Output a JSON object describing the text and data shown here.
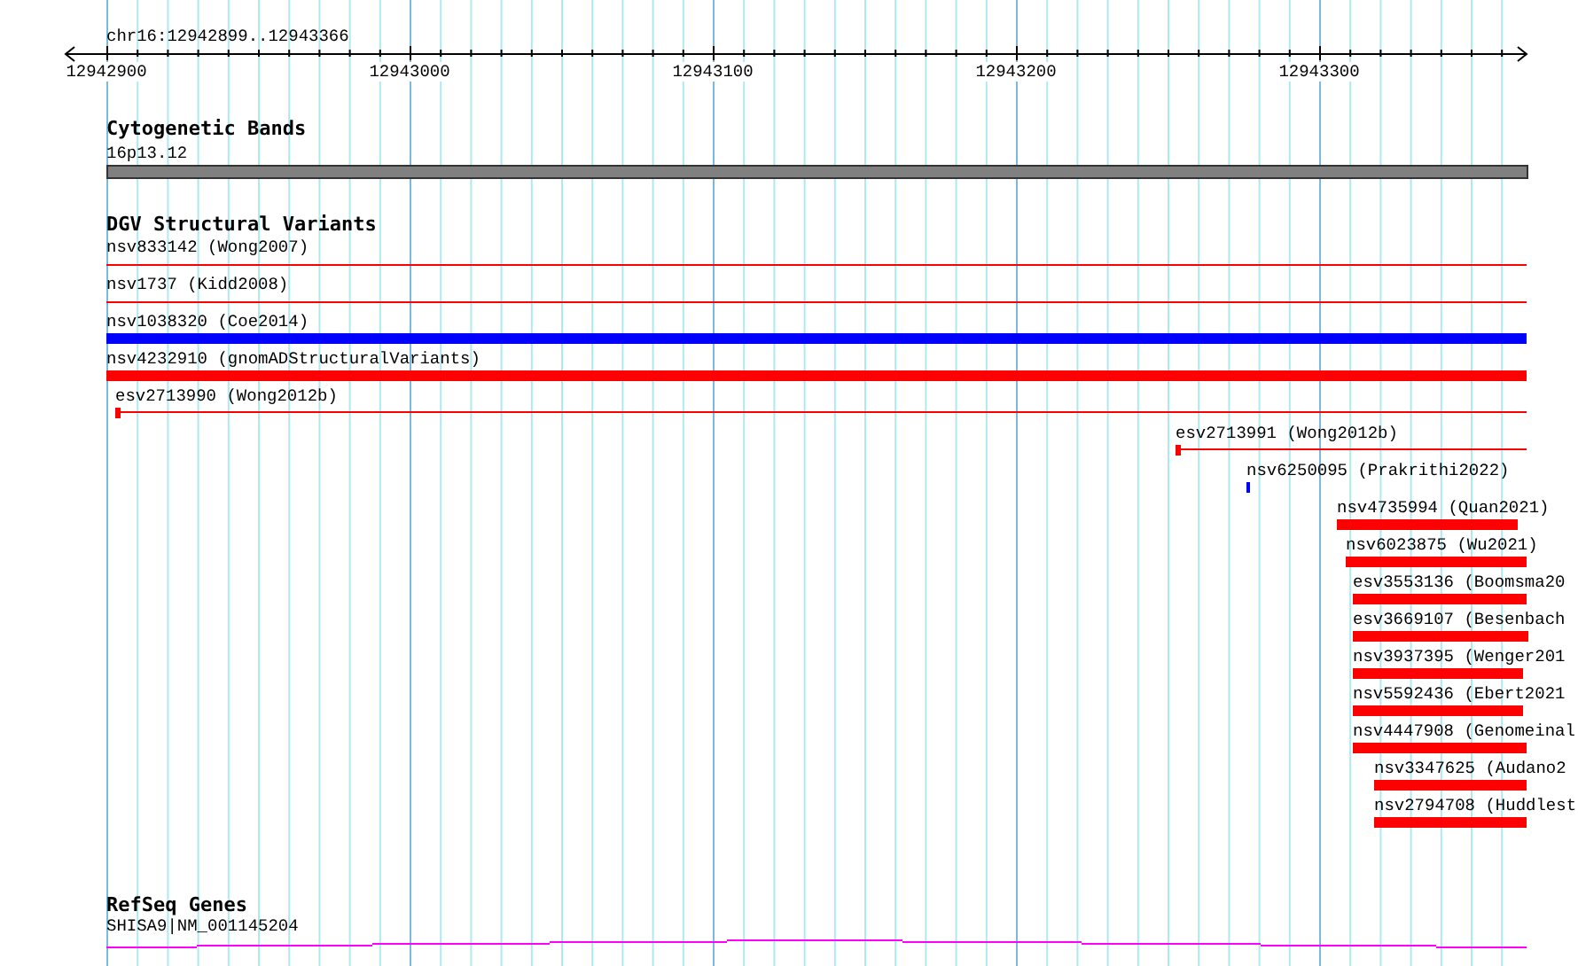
{
  "location": "chr16:12942899..12943366",
  "axis": {
    "labels": [
      "12942900",
      "12943000",
      "12943100",
      "12943200",
      "12943300"
    ]
  },
  "cytoband_track": {
    "title": "Cytogenetic Bands",
    "band": "16p13.12"
  },
  "dgv_track": {
    "title": "DGV Structural Variants",
    "features": [
      {
        "label": "nsv833142 (Wong2007)",
        "kind": "span",
        "color": "#ff0000"
      },
      {
        "label": "nsv1737 (Kidd2008)",
        "kind": "span",
        "color": "#ff0000"
      },
      {
        "label": "nsv1038320 (Coe2014)",
        "kind": "bar",
        "color": "#0000ff"
      },
      {
        "label": "nsv4232910 (gnomADStructuralVariants)",
        "kind": "bar",
        "color": "#ff0000"
      },
      {
        "label": "esv2713990 (Wong2012b)",
        "kind": "marked-span",
        "color": "#ff0000"
      },
      {
        "label": "esv2713991 (Wong2012b)",
        "kind": "marked-span",
        "color": "#ff0000"
      },
      {
        "label": "nsv6250095 (Prakrithi2022)",
        "kind": "mark",
        "color": "#0000ff"
      },
      {
        "label": "nsv4735994 (Quan2021)",
        "kind": "bar",
        "color": "#ff0000"
      },
      {
        "label": "nsv6023875 (Wu2021)",
        "kind": "bar",
        "color": "#ff0000"
      },
      {
        "label": "esv3553136 (Boomsma20",
        "kind": "bar",
        "color": "#ff0000"
      },
      {
        "label": "esv3669107 (Besenbach",
        "kind": "bar",
        "color": "#ff0000"
      },
      {
        "label": "nsv3937395 (Wenger201",
        "kind": "bar",
        "color": "#ff0000"
      },
      {
        "label": "nsv5592436 (Ebert2021",
        "kind": "bar",
        "color": "#ff0000"
      },
      {
        "label": "nsv4447908 (Genomeinal",
        "kind": "bar",
        "color": "#ff0000"
      },
      {
        "label": "nsv3347625 (Audano2",
        "kind": "bar",
        "color": "#ff0000"
      },
      {
        "label": "nsv2794708 (Huddlest",
        "kind": "bar",
        "color": "#ff0000"
      }
    ]
  },
  "refseq_track": {
    "title": "RefSeq Genes",
    "gene": "SHISA9|NM_001145204"
  }
}
